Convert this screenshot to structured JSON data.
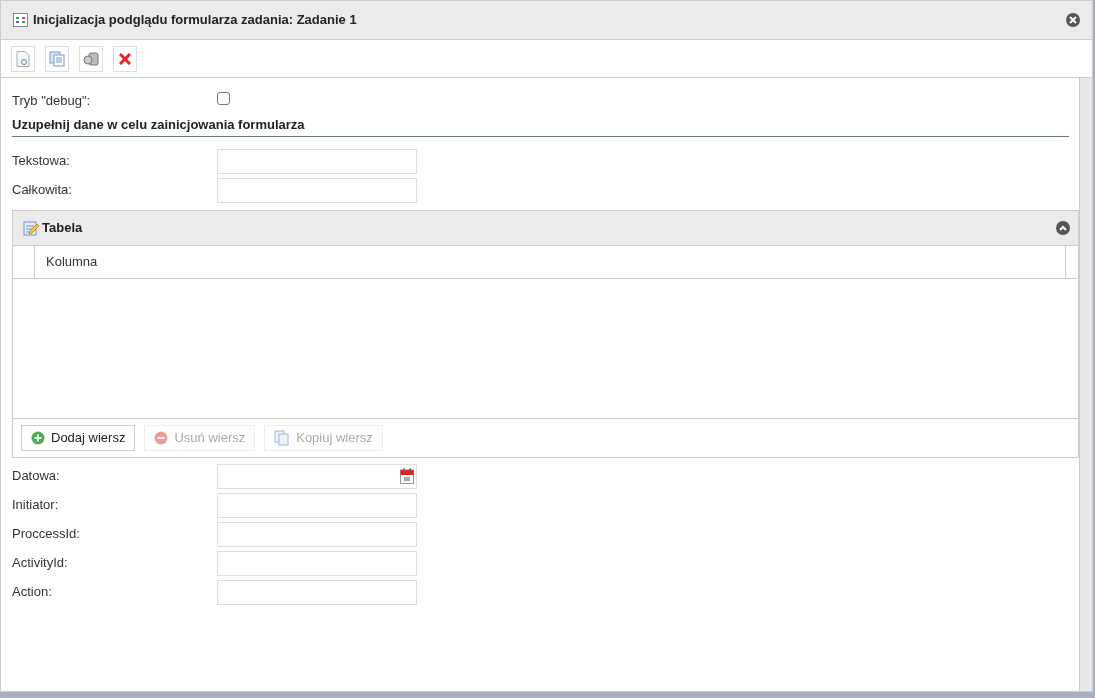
{
  "window": {
    "title": "Inicjalizacja podglądu formularza zadania: Zadanie 1"
  },
  "debug": {
    "label": "Tryb \"debug\":",
    "checked": false
  },
  "section_title": "Uzupełnij dane w celu zainicjowania formularza",
  "fields_before": [
    {
      "label": "Tekstowa:",
      "kind": "text"
    },
    {
      "label": "Całkowita:",
      "kind": "text"
    }
  ],
  "table": {
    "title": "Tabela",
    "expanded": true,
    "columns": [
      "Kolumna"
    ],
    "buttons": [
      {
        "label": "Dodaj wiersz",
        "kind": "add",
        "disabled": false
      },
      {
        "label": "Usuń wiersz",
        "kind": "remove",
        "disabled": true
      },
      {
        "label": "Kopiuj wiersz",
        "kind": "copy",
        "disabled": true
      }
    ]
  },
  "fields_after": [
    {
      "label": "Datowa:",
      "kind": "date"
    },
    {
      "label": "Initiator:",
      "kind": "text"
    },
    {
      "label": "ProccessId:",
      "kind": "text"
    },
    {
      "label": "ActivityId:",
      "kind": "text"
    },
    {
      "label": "Action:",
      "kind": "text"
    }
  ]
}
